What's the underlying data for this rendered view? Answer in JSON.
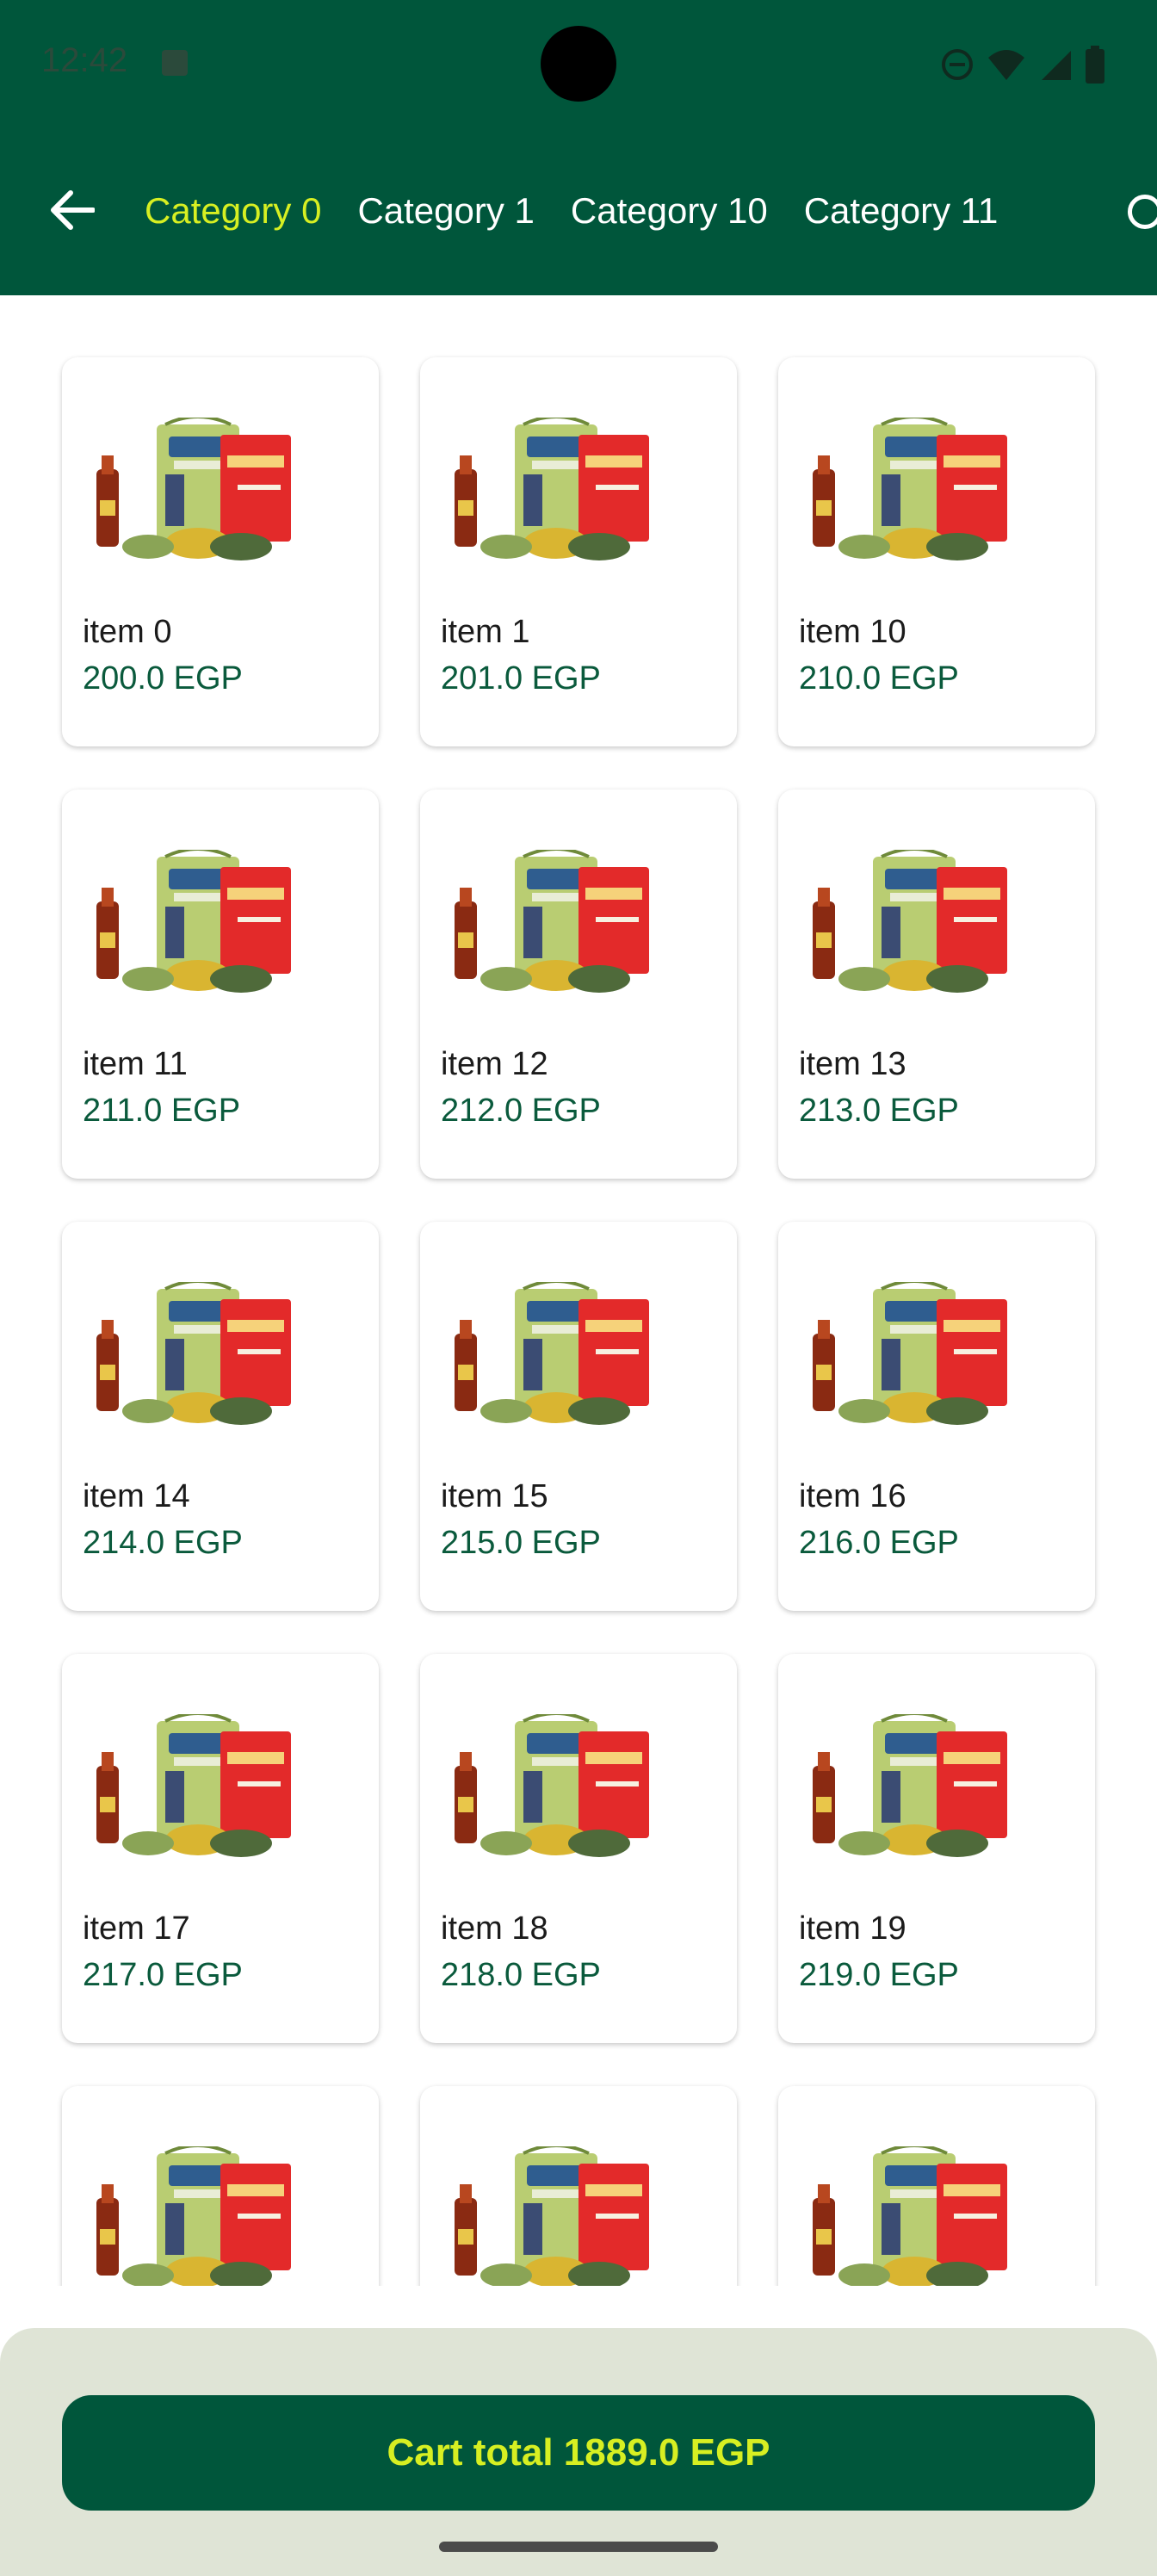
{
  "status_bar": {
    "time": "12:42",
    "icons": [
      "android-a-icon",
      "dnd-icon",
      "wifi-icon",
      "signal-icon",
      "battery-icon"
    ]
  },
  "header": {
    "back_icon": "arrow-left-icon",
    "tabs": [
      {
        "label": "Category 0",
        "active": true
      },
      {
        "label": "Category 1",
        "active": false
      },
      {
        "label": "Category 10",
        "active": false
      },
      {
        "label": "Category 11",
        "active": false
      }
    ]
  },
  "products": [
    {
      "name": "item 0",
      "price": "200.0 EGP"
    },
    {
      "name": "item 1",
      "price": "201.0 EGP"
    },
    {
      "name": "item 10",
      "price": "210.0 EGP"
    },
    {
      "name": "item 11",
      "price": "211.0 EGP"
    },
    {
      "name": "item 12",
      "price": "212.0 EGP"
    },
    {
      "name": "item 13",
      "price": "213.0 EGP"
    },
    {
      "name": "item 14",
      "price": "214.0 EGP"
    },
    {
      "name": "item 15",
      "price": "215.0 EGP"
    },
    {
      "name": "item 16",
      "price": "216.0 EGP"
    },
    {
      "name": "item 17",
      "price": "217.0 EGP"
    },
    {
      "name": "item 18",
      "price": "218.0 EGP"
    },
    {
      "name": "item 19",
      "price": "219.0 EGP"
    },
    {
      "name": "",
      "price": ""
    },
    {
      "name": "",
      "price": ""
    },
    {
      "name": "",
      "price": ""
    }
  ],
  "cart": {
    "total_label": "Cart total 1889.0 EGP"
  },
  "colors": {
    "primary": "#00563b",
    "accent": "#d7ef22",
    "price": "#0a5a3c",
    "cart_panel": "#dfe4d6"
  }
}
